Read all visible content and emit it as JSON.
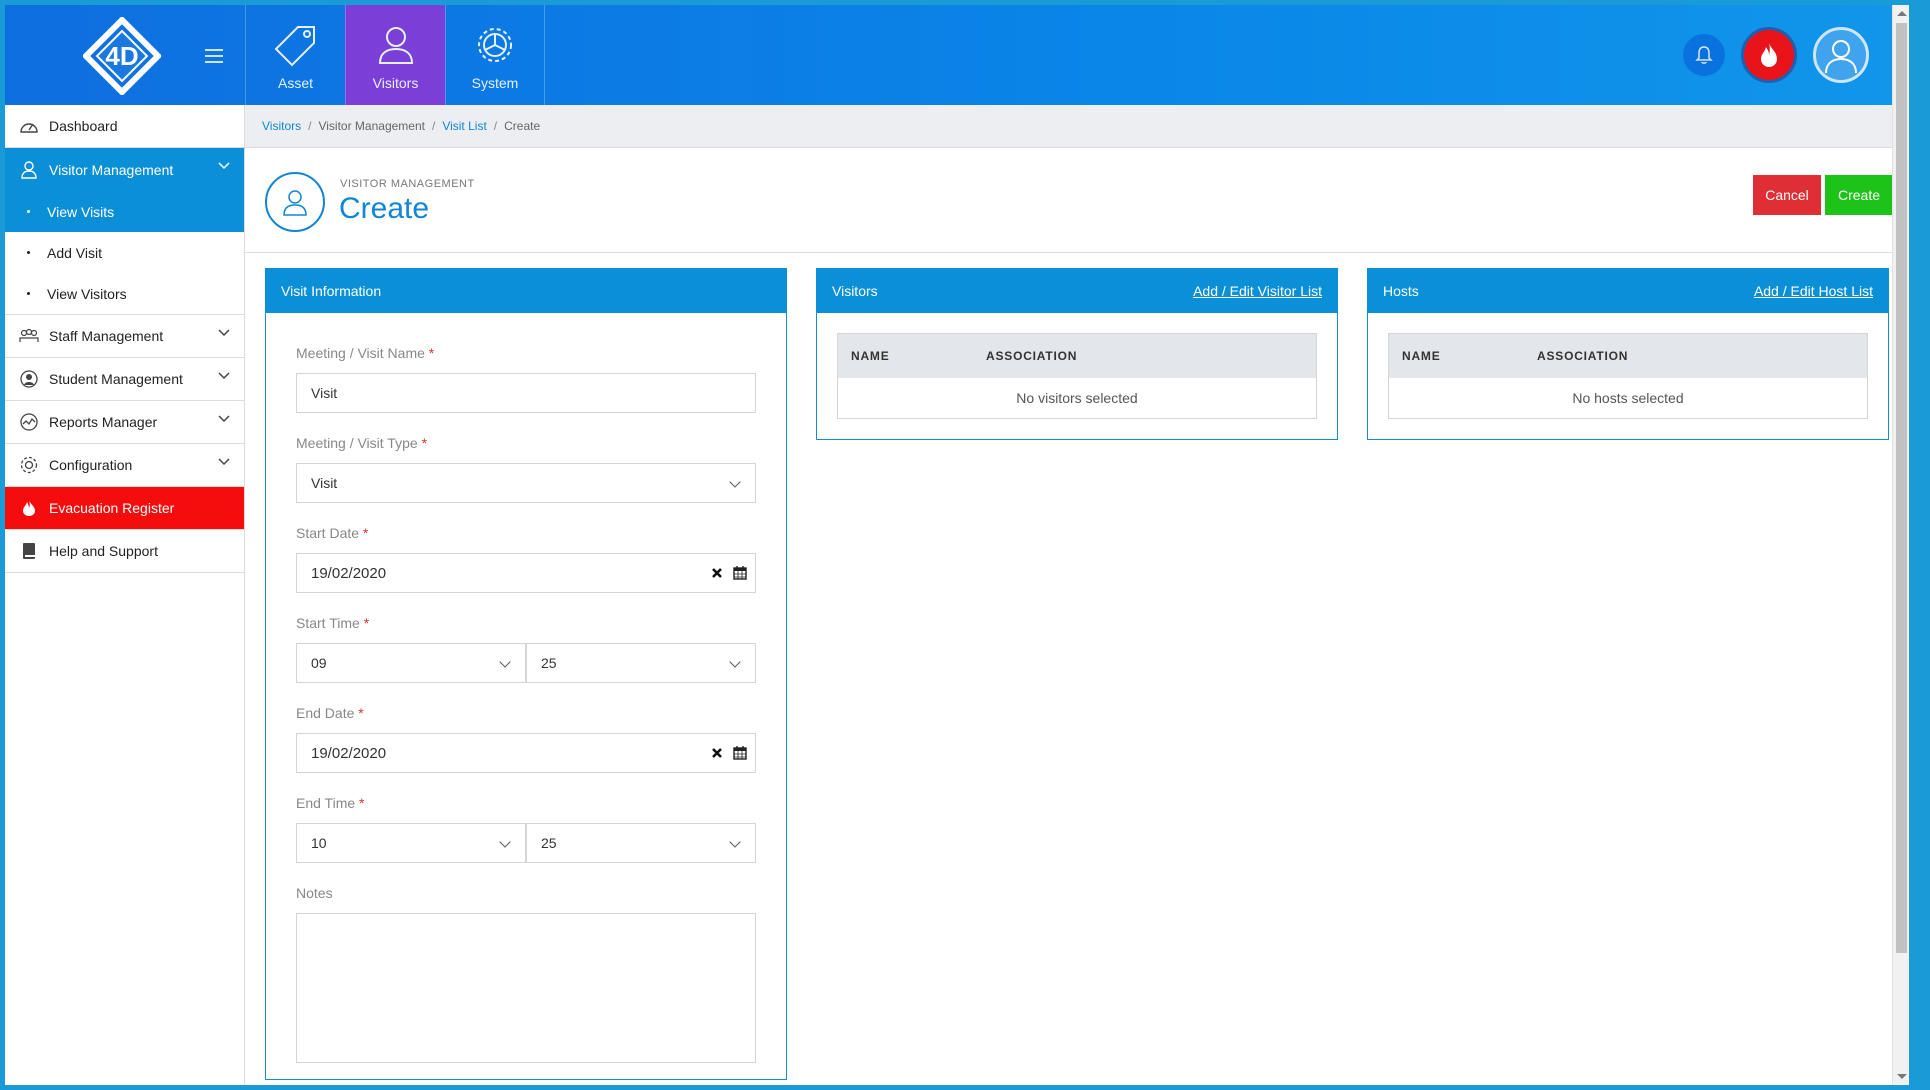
{
  "header": {
    "modules": [
      {
        "label": "Asset",
        "icon": "tag-icon"
      },
      {
        "label": "Visitors",
        "icon": "person-icon"
      },
      {
        "label": "System",
        "icon": "gear-icon"
      }
    ]
  },
  "sidebar": {
    "dashboard": "Dashboard",
    "visitor_management": "Visitor Management",
    "view_visits": "View Visits",
    "add_visit": "Add Visit",
    "view_visitors": "View Visitors",
    "staff_management": "Staff Management",
    "student_management": "Student Management",
    "reports_manager": "Reports Manager",
    "configuration": "Configuration",
    "evacuation_register": "Evacuation Register",
    "help_support": "Help and Support"
  },
  "breadcrumb": [
    "Visitors",
    "Visitor Management",
    "Visit List",
    "Create"
  ],
  "page": {
    "subtitle": "VISITOR MANAGEMENT",
    "title": "Create",
    "cancel": "Cancel",
    "create": "Create"
  },
  "visit_info": {
    "title": "Visit Information",
    "name_label": "Meeting / Visit Name",
    "name_value": "Visit",
    "type_label": "Meeting / Visit Type",
    "type_value": "Visit",
    "start_date_label": "Start Date",
    "start_date_value": "19/02/2020",
    "start_time_label": "Start Time",
    "start_hour": "09",
    "start_min": "25",
    "end_date_label": "End Date",
    "end_date_value": "19/02/2020",
    "end_time_label": "End Time",
    "end_hour": "10",
    "end_min": "25",
    "notes_label": "Notes",
    "required_mark": "*"
  },
  "visitors": {
    "title": "Visitors",
    "link": "Add / Edit Visitor List",
    "col_name": "NAME",
    "col_assoc": "ASSOCIATION",
    "empty": "No visitors selected"
  },
  "hosts": {
    "title": "Hosts",
    "link": "Add / Edit Host List",
    "col_name": "NAME",
    "col_assoc": "ASSOCIATION",
    "empty": "No hosts selected"
  },
  "colors": {
    "primary": "#0b90d8",
    "active_module": "#7b3fd8",
    "evacuation": "#f50c0c",
    "cancel": "#e02e35",
    "create": "#1ec319"
  }
}
